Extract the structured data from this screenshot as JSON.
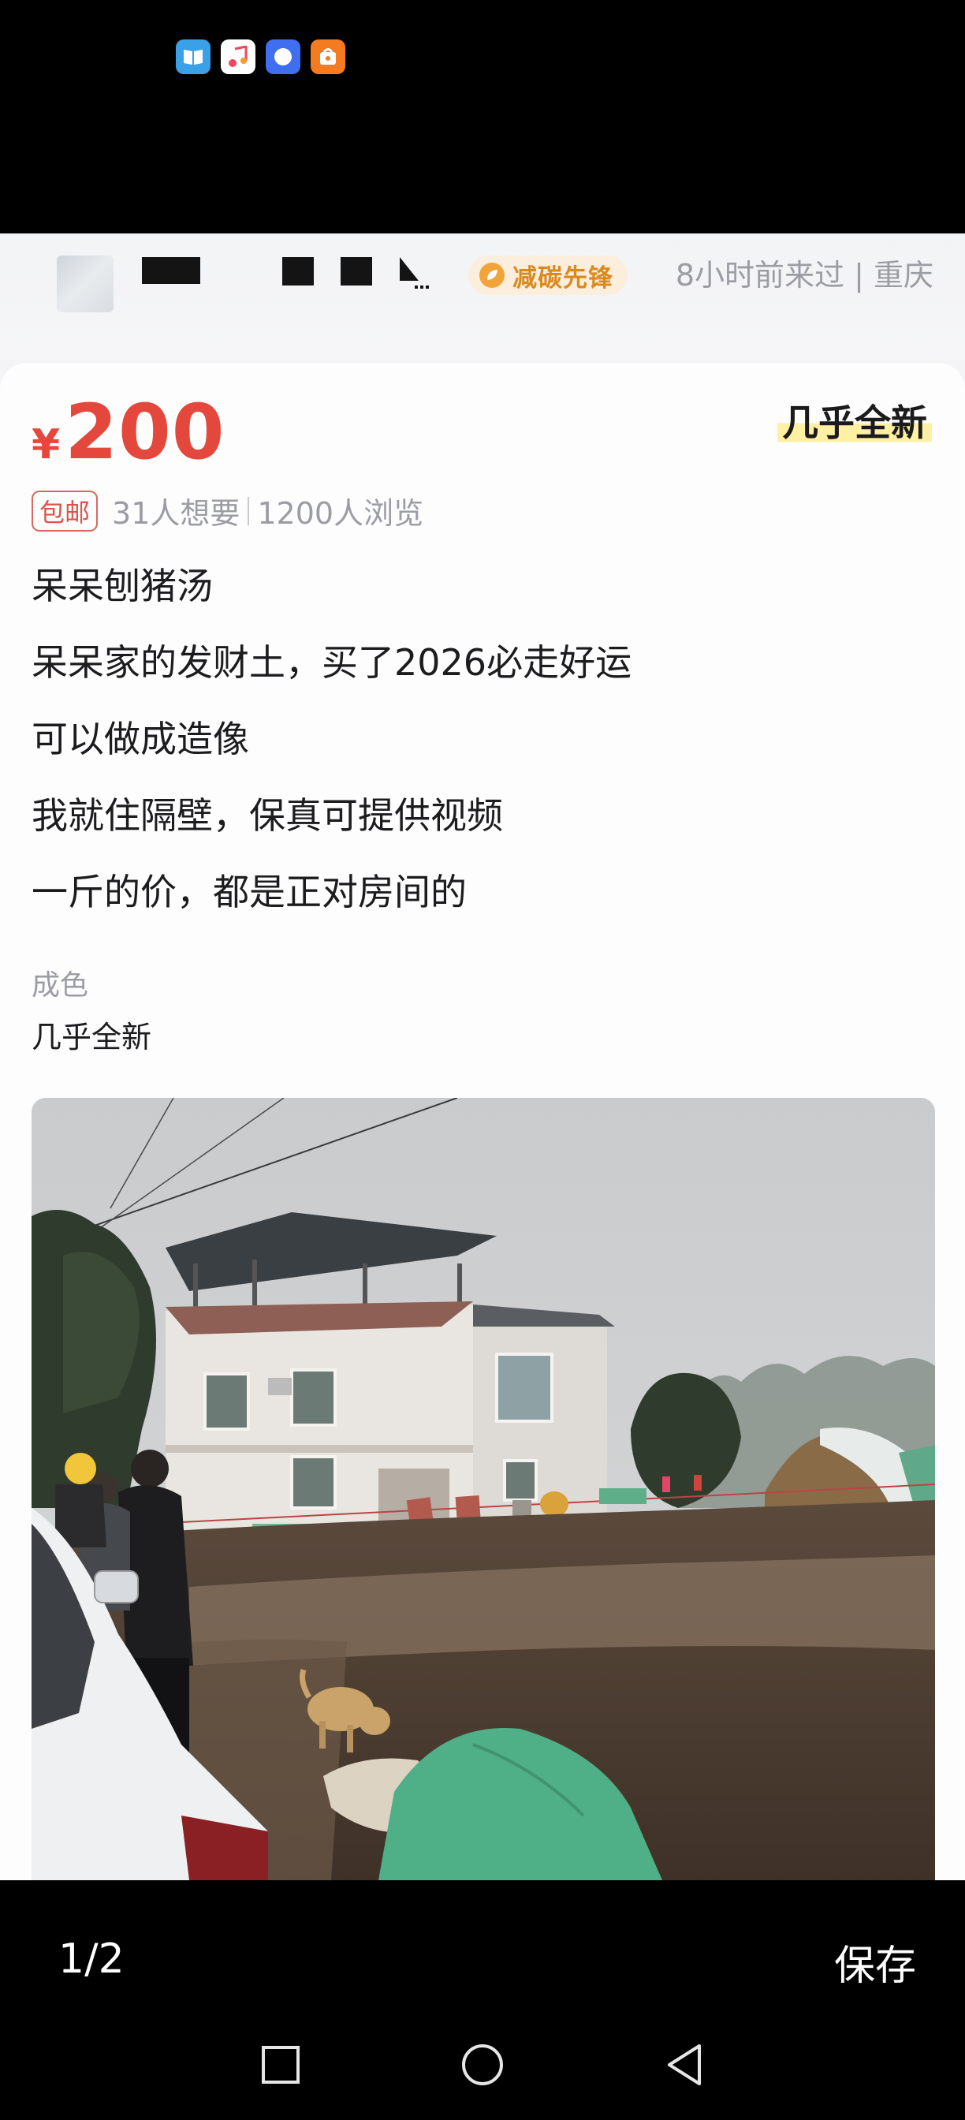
{
  "status_bar": {
    "app_icons": [
      "book-app-icon",
      "music-app-icon",
      "browser-app-icon",
      "shop-app-icon"
    ]
  },
  "seller": {
    "badge_label": "减碳先锋",
    "last_seen": "8小时前来过 | 重庆"
  },
  "listing": {
    "currency": "¥",
    "price": "200",
    "condition_tag": "几乎全新",
    "shipping_badge": "包邮",
    "wants": "31人想要",
    "views": "1200人浏览",
    "description": [
      "呆呆刨猪汤",
      "呆呆家的发财土，买了2026必走好运",
      "可以做成造像",
      "我就住隔壁，保真可提供视频",
      "一斤的价，都是正对房间的"
    ],
    "condition_label": "成色",
    "condition_value": "几乎全新"
  },
  "viewer": {
    "page_indicator": "1/2",
    "save_label": "保存"
  },
  "colors": {
    "price_red": "#e4473c",
    "badge_orange": "#d98a1e",
    "muted_text": "#9b9da3"
  }
}
